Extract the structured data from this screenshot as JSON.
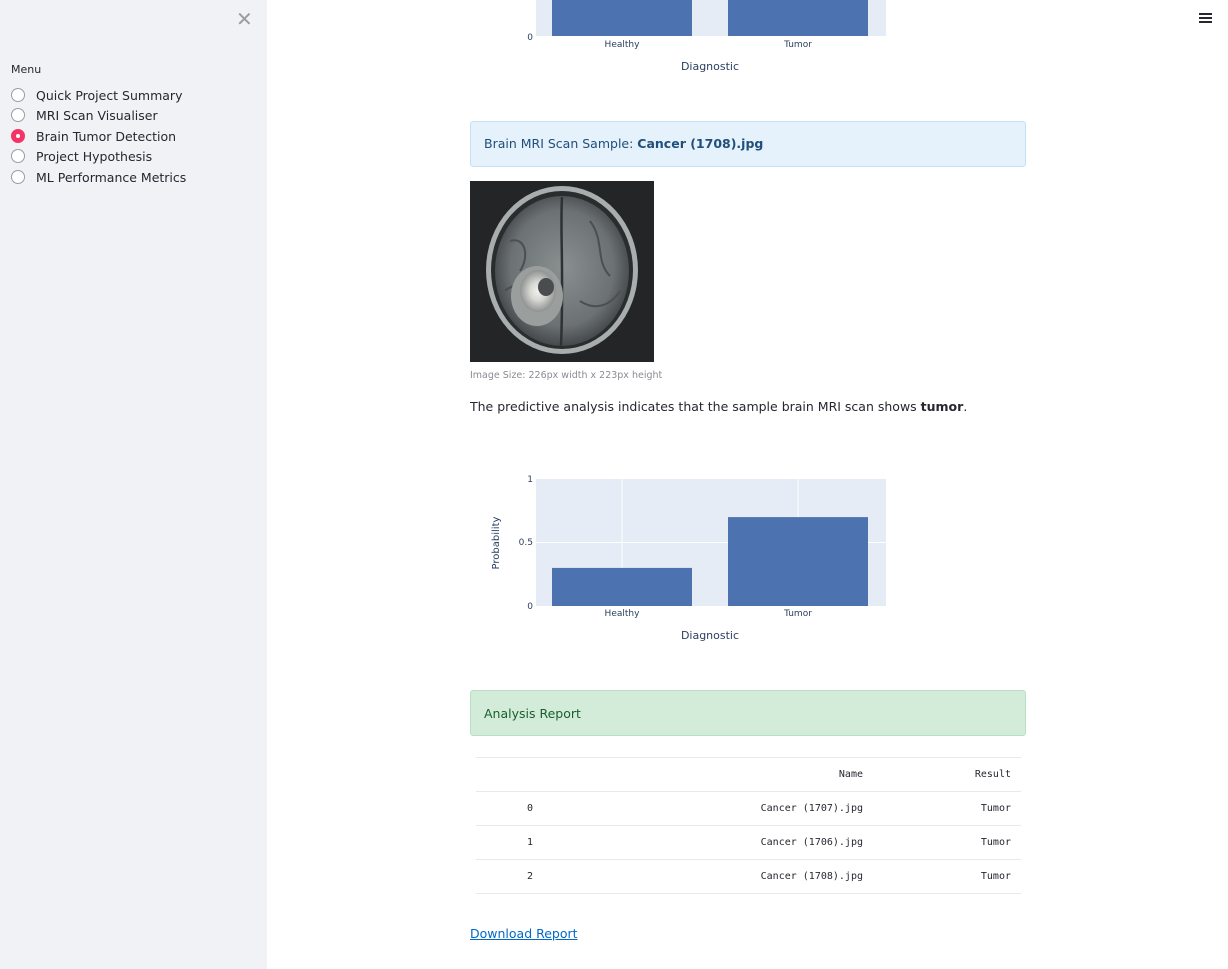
{
  "sidebar": {
    "menu_label": "Menu",
    "items": [
      {
        "label": "Quick Project Summary",
        "selected": false
      },
      {
        "label": "MRI Scan Visualiser",
        "selected": false
      },
      {
        "label": "Brain Tumor Detection",
        "selected": true
      },
      {
        "label": "Project Hypothesis",
        "selected": false
      },
      {
        "label": "ML Performance Metrics",
        "selected": false
      }
    ]
  },
  "colors": {
    "accent": "#f63366",
    "bar": "#4c72b0",
    "plot_bg": "#e5ecf6",
    "info_bg": "#e5f1fb",
    "success_bg": "#d3ecd9",
    "link": "#0068c9"
  },
  "sample": {
    "prefix": "Brain MRI Scan Sample: ",
    "filename": "Cancer (1708).jpg",
    "caption": "Image Size: 226px width x 223px height",
    "prediction_text": "The predictive analysis indicates that the sample brain MRI scan shows ",
    "prediction_value": "tumor",
    "prediction_suffix": "."
  },
  "chart_data": [
    {
      "type": "bar",
      "categories": [
        "Healthy",
        "Tumor"
      ],
      "values": [
        0.3,
        0.7
      ],
      "xlabel": "Diagnostic",
      "ylabel": "",
      "ylim": [
        0,
        1
      ],
      "yticks": [
        "0"
      ],
      "partially_visible": true
    },
    {
      "type": "bar",
      "categories": [
        "Healthy",
        "Tumor"
      ],
      "values": [
        0.3,
        0.7
      ],
      "xlabel": "Diagnostic",
      "ylabel": "Probability",
      "ylim": [
        0,
        1
      ],
      "yticks": [
        "0",
        "0.5",
        "1"
      ],
      "grid": true
    }
  ],
  "report": {
    "title": "Analysis Report",
    "columns": [
      "",
      "Name",
      "Result"
    ],
    "rows": [
      {
        "index": "0",
        "name": "Cancer (1707).jpg",
        "result": "Tumor"
      },
      {
        "index": "1",
        "name": "Cancer (1706).jpg",
        "result": "Tumor"
      },
      {
        "index": "2",
        "name": "Cancer (1708).jpg",
        "result": "Tumor"
      }
    ],
    "download_label": "Download Report"
  }
}
